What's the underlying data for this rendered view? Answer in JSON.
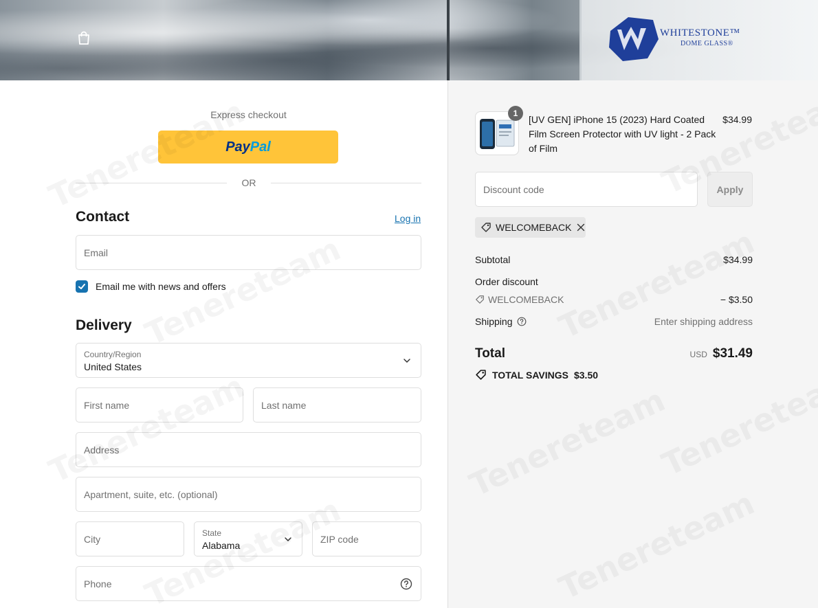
{
  "banner": {
    "logo_text": "WHITESTONE™",
    "logo_sub": "DOME GLASS®",
    "bag_icon": "shopping-bag-icon"
  },
  "express": {
    "label": "Express checkout",
    "paypal_part1": "Pay",
    "paypal_part2": "Pal",
    "or_label": "OR"
  },
  "contact": {
    "title": "Contact",
    "login_label": "Log in",
    "email_placeholder": "Email",
    "newsletter_label": "Email me with news and offers",
    "newsletter_checked": true
  },
  "delivery": {
    "title": "Delivery",
    "country_label": "Country/Region",
    "country_value": "United States",
    "first_name_placeholder": "First name",
    "last_name_placeholder": "Last name",
    "address_placeholder": "Address",
    "apartment_placeholder": "Apartment, suite, etc. (optional)",
    "city_placeholder": "City",
    "state_label": "State",
    "state_value": "Alabama",
    "zip_placeholder": "ZIP code",
    "phone_placeholder": "Phone"
  },
  "summary": {
    "product_name": "[UV GEN] iPhone 15 (2023) Hard Coated Film Screen Protector with UV light - 2 Pack of Film",
    "product_price": "$34.99",
    "quantity": "1",
    "discount_placeholder": "Discount code",
    "apply_label": "Apply",
    "applied_code": "WELCOMEBACK",
    "subtotal_label": "Subtotal",
    "subtotal_value": "$34.99",
    "order_discount_label": "Order discount",
    "order_discount_code": "WELCOMEBACK",
    "order_discount_value": "− $3.50",
    "shipping_label": "Shipping",
    "shipping_value": "Enter shipping address",
    "total_label": "Total",
    "currency": "USD",
    "total_value": "$31.49",
    "savings_label": "TOTAL SAVINGS",
    "savings_value": "$3.50"
  },
  "colors": {
    "accent": "#1773b0",
    "paypal_yellow": "#ffc439",
    "summary_bg": "#f5f5f5"
  }
}
